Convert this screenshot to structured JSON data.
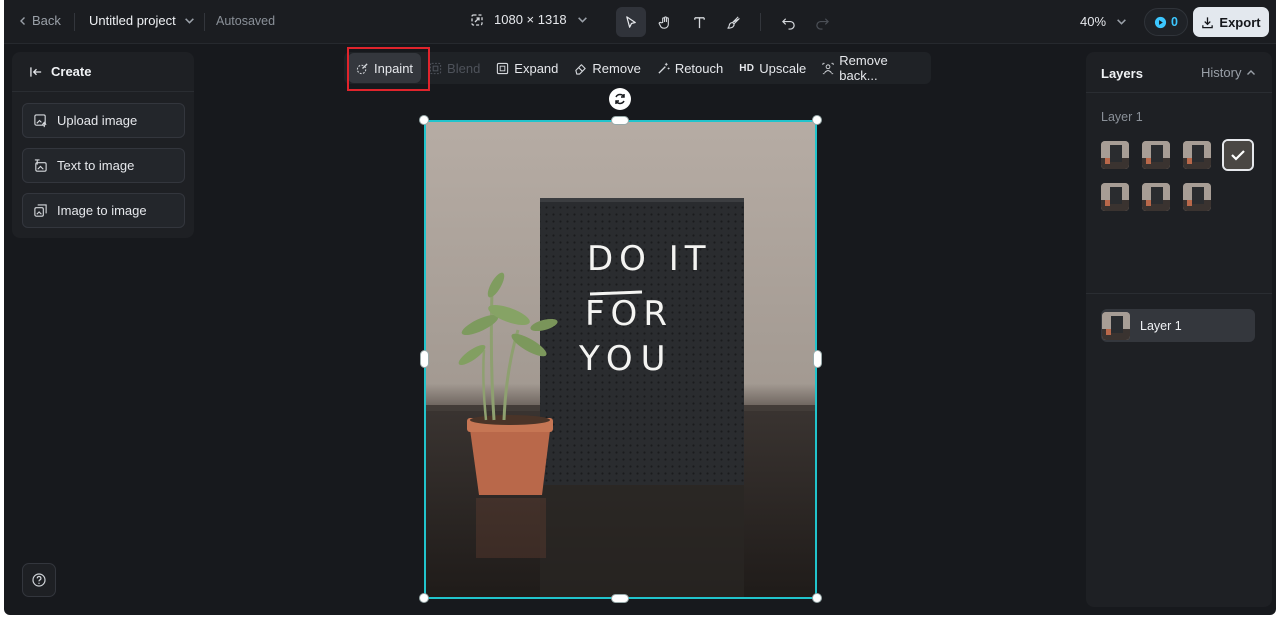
{
  "topbar": {
    "back_label": "Back",
    "project_name": "Untitled project",
    "autosave_status": "Autosaved",
    "canvas_size": "1080 × 1318",
    "zoom": "40%",
    "credits": "0",
    "export_label": "Export"
  },
  "tools": [
    "select-tool",
    "hand-tool",
    "text-tool",
    "brush-tool",
    "undo",
    "redo"
  ],
  "left_panel": {
    "header": "Create",
    "buttons": [
      "Upload image",
      "Text to image",
      "Image to image"
    ]
  },
  "edit_toolbar": {
    "items": [
      "Inpaint",
      "Blend",
      "Expand",
      "Remove",
      "Retouch",
      "Upscale",
      "Remove back..."
    ],
    "hd_badge": "HD",
    "highlighted": "Inpaint"
  },
  "canvas": {
    "image_text": [
      "DO IT",
      "FOR",
      "YOU"
    ]
  },
  "right_panel": {
    "tab_layers": "Layers",
    "tab_history": "History",
    "group_label": "Layer 1",
    "layer_row_label": "Layer 1"
  },
  "colors": {
    "accent": "#21c4cc",
    "highlight": "#e0242c",
    "credits": "#3cc7ff"
  }
}
